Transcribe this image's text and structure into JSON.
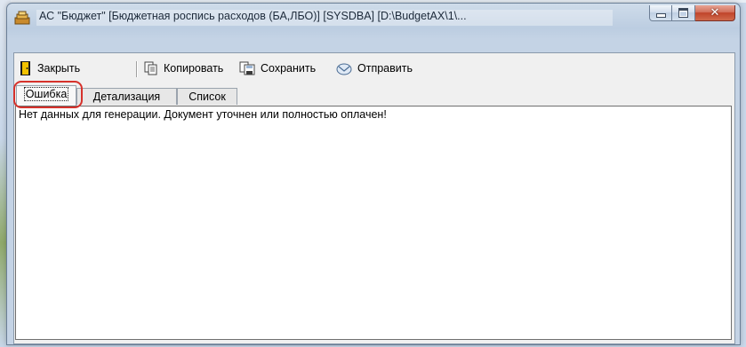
{
  "window": {
    "title": "АС \"Бюджет\" [Бюджетная роспись расходов (БА,ЛБО)] [SYSDBA] [D:\\BudgetAX\\1\\...",
    "icon": "budget-app-icon",
    "controls": {
      "minimize": "minimize-icon",
      "maximize": "maximize-icon",
      "close": "✕"
    }
  },
  "toolbar": {
    "close_label": "Закрыть",
    "copy_label": "Копировать",
    "save_label": "Сохранить",
    "send_label": "Отправить"
  },
  "tabs": [
    {
      "label": "Ошибка",
      "active": true
    },
    {
      "label": "Детализация",
      "active": false
    },
    {
      "label": "Список",
      "active": false
    }
  ],
  "content": {
    "message": "Нет данных для генерации. Документ уточнен или полностью оплачен!"
  },
  "colors": {
    "highlight": "#d6312b",
    "titlebar": "#c4d3e5",
    "close_button": "#c0442a"
  }
}
